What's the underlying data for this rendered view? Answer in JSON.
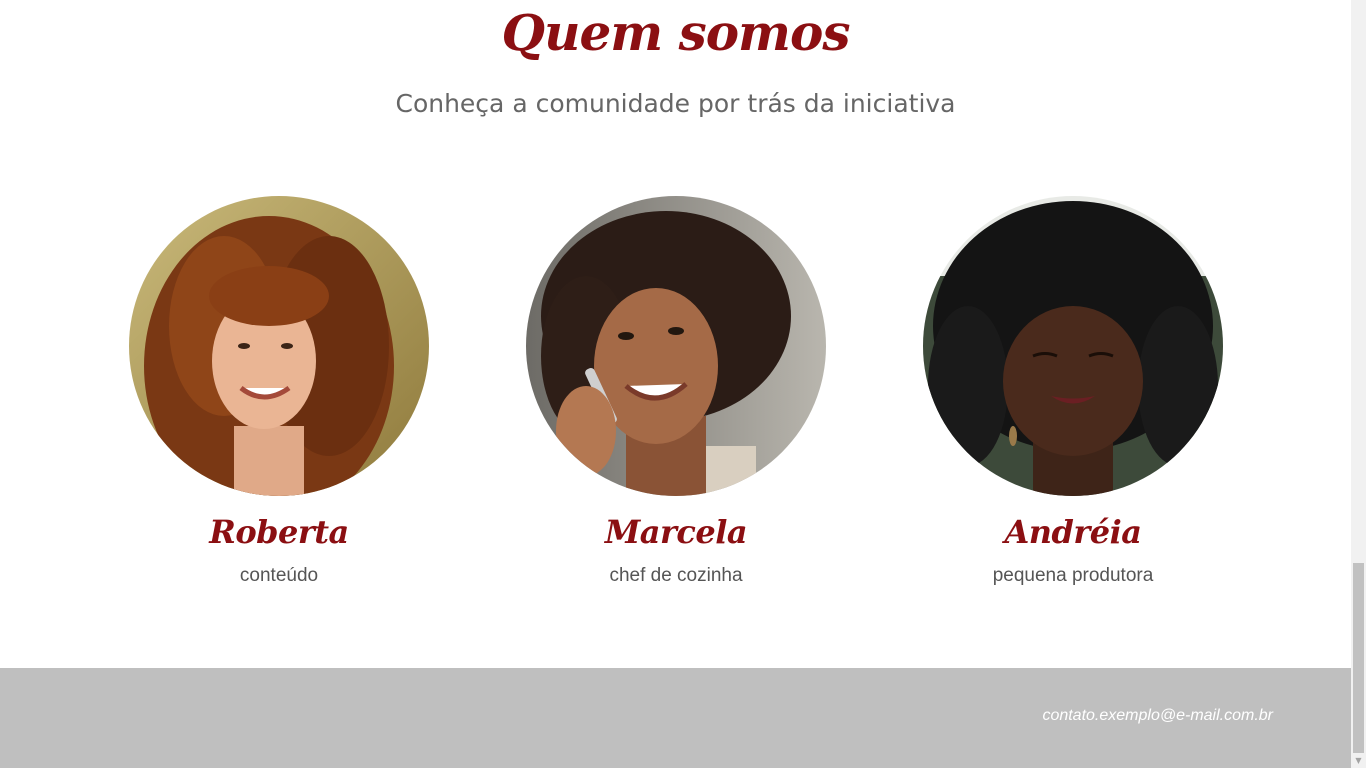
{
  "section": {
    "title": "Quem somos",
    "subtitle": "Conheça a comunidade por trás da iniciativa"
  },
  "members": [
    {
      "name": "Roberta",
      "role": "conteúdo",
      "photo": "woman-curly-red-hair-portrait"
    },
    {
      "name": "Marcela",
      "role": "chef de cozinha",
      "photo": "woman-on-phone-portrait"
    },
    {
      "name": "Andréia",
      "role": "pequena produtora",
      "photo": "woman-afro-hair-portrait"
    }
  ],
  "footer": {
    "email": "contato.exemplo@e-mail.com.br"
  },
  "colors": {
    "accent": "#8b0f12",
    "footer_bg": "#bfbfbf",
    "text_muted": "#555555"
  },
  "scrollbar": {
    "down_arrow_icon": "chevron-down-icon"
  }
}
